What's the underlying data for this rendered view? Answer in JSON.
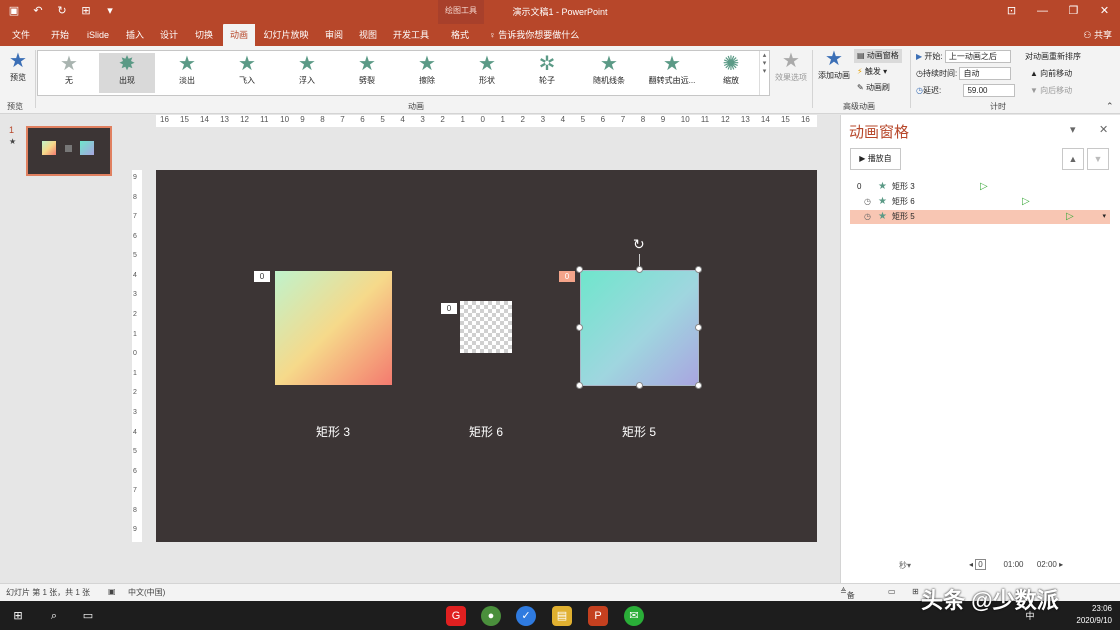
{
  "titlebar": {
    "tools_context": "绘图工具",
    "doc_title": "演示文稿1  -  PowerPoint"
  },
  "menu": {
    "tabs": [
      "文件",
      "开始",
      "iSlide",
      "插入",
      "设计",
      "切换",
      "动画",
      "幻灯片放映",
      "审阅",
      "视图",
      "开发工具",
      "格式"
    ],
    "active": "动画",
    "tell_me": "告诉我你想要做什么",
    "share": "共享"
  },
  "ribbon": {
    "preview_label": "预览",
    "preview_group": "预览",
    "animation_group": "动画",
    "advanced_group": "高级动画",
    "timing_group": "计时",
    "animations": [
      "无",
      "出现",
      "淡出",
      "飞入",
      "浮入",
      "劈裂",
      "擦除",
      "形状",
      "轮子",
      "随机线条",
      "翻转式由远...",
      "缩放"
    ],
    "selected_animation": "出现",
    "effect_options": "效果选项",
    "add_animation": "添加动画",
    "animation_pane_btn": "动画窗格",
    "trigger": "触发",
    "animation_painter": "动画刷",
    "start_label": "开始:",
    "start_value": "上一动画之后",
    "duration_label": "持续时间:",
    "duration_value": "自动",
    "delay_label": "延迟:",
    "delay_value": "59.00",
    "reorder_label": "对动画重新排序",
    "move_earlier": "向前移动",
    "move_later": "向后移动"
  },
  "thumbnails": {
    "slide_number": "1",
    "star": "★"
  },
  "ruler": {
    "h_ticks": [
      "16",
      "15",
      "14",
      "13",
      "12",
      "11",
      "10",
      "9",
      "8",
      "7",
      "6",
      "5",
      "4",
      "3",
      "2",
      "1",
      "0",
      "1",
      "2",
      "3",
      "4",
      "5",
      "6",
      "7",
      "8",
      "9",
      "10",
      "11",
      "12",
      "13",
      "14",
      "15",
      "16"
    ],
    "v_ticks": [
      "9",
      "8",
      "7",
      "6",
      "5",
      "4",
      "3",
      "2",
      "1",
      "0",
      "1",
      "2",
      "3",
      "4",
      "5",
      "6",
      "7",
      "8",
      "9"
    ]
  },
  "slide": {
    "shapes": [
      {
        "label": "矩形 3",
        "tag": "0"
      },
      {
        "label": "矩形 6",
        "tag": "0"
      },
      {
        "label": "矩形 5",
        "tag": "0"
      }
    ]
  },
  "animation_pane": {
    "title": "动画窗格",
    "play_from": "播放自",
    "items": [
      {
        "index": "0",
        "name": "矩形 3"
      },
      {
        "index": "",
        "name": "矩形 6"
      },
      {
        "index": "",
        "name": "矩形 5"
      }
    ],
    "seconds_label": "秒",
    "timeline_labels": [
      "0",
      "01:00",
      "02:00"
    ]
  },
  "status": {
    "slide_info": "幻灯片 第 1 张，共 1 张",
    "language": "中文(中国)",
    "notes": "备注"
  },
  "taskbar": {
    "time": "23:06",
    "date": "2020/9/10",
    "ime": "中"
  },
  "watermark": "头条 @少数派"
}
